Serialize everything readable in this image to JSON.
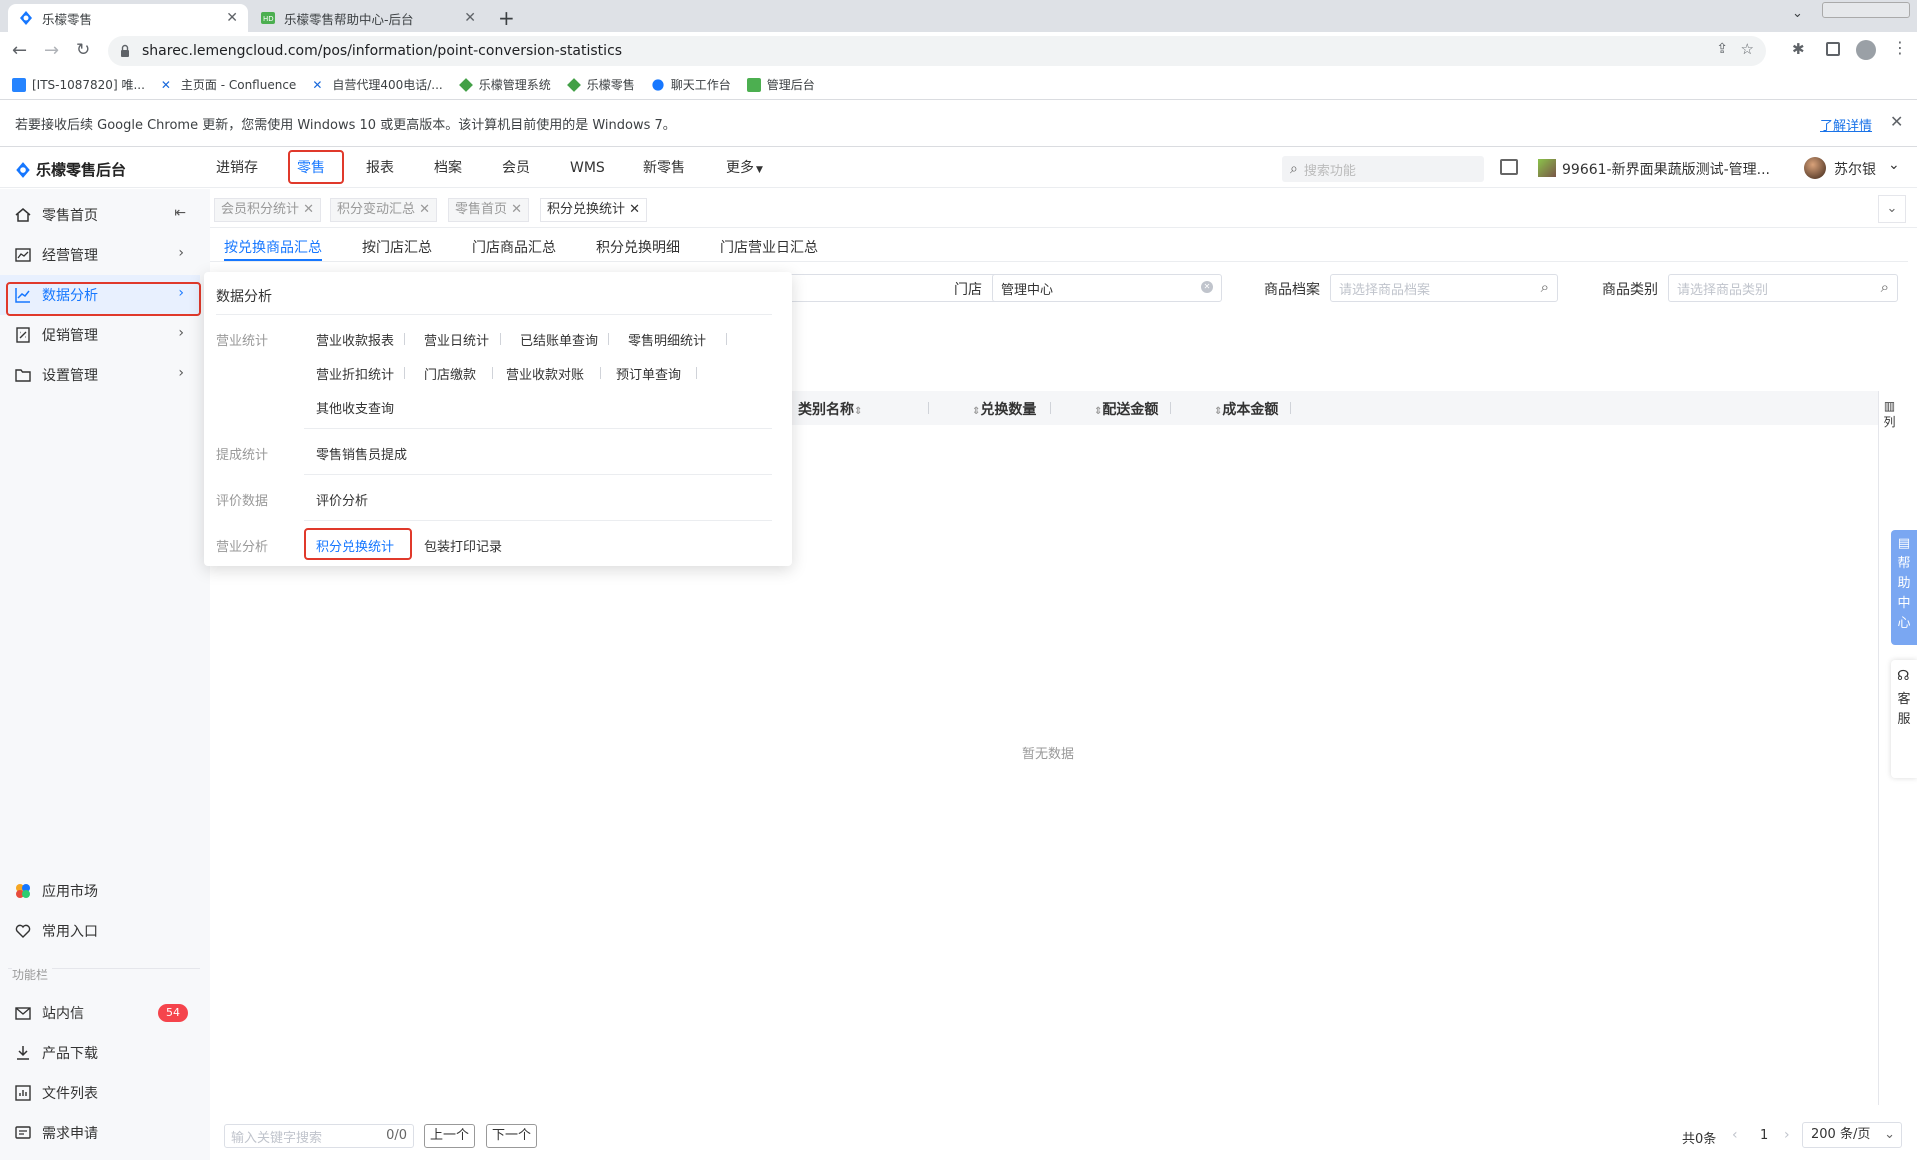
{
  "browser": {
    "tabs": [
      {
        "title": "乐檬零售"
      },
      {
        "title": "乐檬零售帮助中心-后台"
      }
    ],
    "url": "sharec.lemengcloud.com/pos/information/point-conversion-statistics",
    "bookmarks": [
      {
        "label": "[ITS-1087820] 唯..."
      },
      {
        "label": "主页面 - Confluence"
      },
      {
        "label": "自营代理400电话/..."
      },
      {
        "label": "乐檬管理系统"
      },
      {
        "label": "乐檬零售"
      },
      {
        "label": "聊天工作台"
      },
      {
        "label": "管理后台"
      }
    ],
    "infobar": {
      "message": "若要接收后续 Google Chrome 更新，您需使用 Windows 10 或更高版本。该计算机目前使用的是 Windows 7。",
      "link": "了解详情"
    }
  },
  "app": {
    "logo": "乐檬零售后台",
    "nav": [
      "进销存",
      "零售",
      "报表",
      "档案",
      "会员",
      "WMS",
      "新零售",
      "更多"
    ],
    "search_placeholder": "搜索功能",
    "store": "99661-新界面果蔬版测试-管理...",
    "user": "苏尔银"
  },
  "sidebar": {
    "items": [
      {
        "label": "零售首页",
        "icon": "home-icon"
      },
      {
        "label": "经营管理",
        "icon": "chart-icon"
      },
      {
        "label": "数据分析",
        "icon": "analytics-icon"
      },
      {
        "label": "促销管理",
        "icon": "promo-icon"
      },
      {
        "label": "设置管理",
        "icon": "folder-icon"
      }
    ],
    "bottom": [
      {
        "label": "应用市场"
      },
      {
        "label": "常用入口"
      }
    ],
    "section_label": "功能栏",
    "tools": [
      {
        "label": "站内信",
        "badge": "54"
      },
      {
        "label": "产品下载"
      },
      {
        "label": "文件列表"
      },
      {
        "label": "需求申请"
      }
    ]
  },
  "page_tabs": [
    "会员积分统计",
    "积分变动汇总",
    "零售首页",
    "积分兑换统计"
  ],
  "sub_tabs": [
    "按兑换商品汇总",
    "按门店汇总",
    "门店商品汇总",
    "积分兑换明细",
    "门店营业日汇总"
  ],
  "filters": {
    "store_label": "门店",
    "store_value": "管理中心",
    "goods_label": "商品档案",
    "goods_placeholder": "请选择商品档案",
    "category_label": "商品类别",
    "category_placeholder": "请选择商品类别"
  },
  "table": {
    "columns": [
      "类别名称",
      "兑换数量",
      "配送金额",
      "成本金额"
    ],
    "column_setting": "列",
    "empty": "暂无数据"
  },
  "menu": {
    "title": "数据分析",
    "sections": [
      {
        "category": "营业统计",
        "links": [
          "营业收款报表",
          "营业日统计",
          "已结账单查询",
          "零售明细统计",
          "营业折扣统计",
          "门店缴款",
          "营业收款对账",
          "预订单查询",
          "其他收支查询"
        ]
      },
      {
        "category": "提成统计",
        "links": [
          "零售销售员提成"
        ]
      },
      {
        "category": "评价数据",
        "links": [
          "评价分析"
        ]
      },
      {
        "category": "营业分析",
        "links": [
          "积分兑换统计",
          "包装打印记录"
        ]
      }
    ]
  },
  "footer": {
    "search_placeholder": "输入关键字搜索",
    "count": "0/0",
    "prev": "上一个",
    "next": "下一个",
    "total": "共0条",
    "page": "1",
    "page_size": "200 条/页"
  },
  "side_widgets": {
    "help": [
      "帮",
      "助",
      "中",
      "心"
    ],
    "service": [
      "客",
      "服"
    ]
  },
  "colors": {
    "accent": "#1677ff",
    "highlight": "#e0392b",
    "badge": "#f5444c"
  }
}
